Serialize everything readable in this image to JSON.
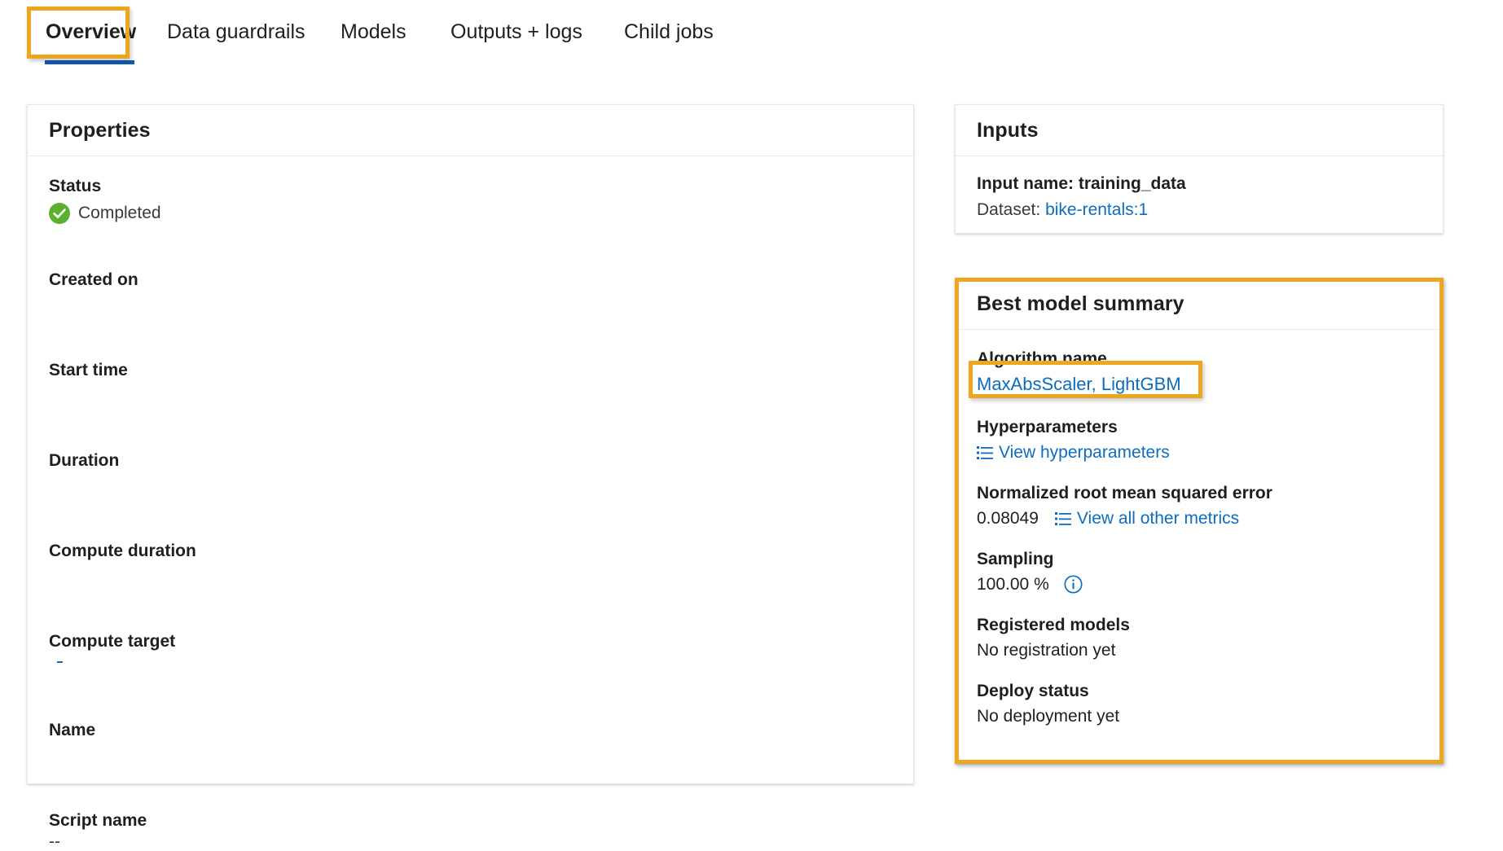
{
  "tabs": [
    {
      "label": "Overview",
      "selected": true
    },
    {
      "label": "Data guardrails",
      "selected": false
    },
    {
      "label": "Models",
      "selected": false
    },
    {
      "label": "Outputs + logs",
      "selected": false
    },
    {
      "label": "Child jobs",
      "selected": false
    }
  ],
  "colors": {
    "annotation_orange": "#eca620",
    "tab_underline_blue": "#0f5bb5",
    "link_blue": "#0f6cbd",
    "status_green": "#5cb030"
  },
  "properties": {
    "title": "Properties",
    "rows": [
      {
        "label": "Status",
        "value": "Completed",
        "icon": "check-circle-icon"
      },
      {
        "label": "Created on",
        "value": ""
      },
      {
        "label": "Start time",
        "value": ""
      },
      {
        "label": "Duration",
        "value": ""
      },
      {
        "label": "Compute duration",
        "value": ""
      },
      {
        "label": "Compute target",
        "value": ""
      },
      {
        "label": "Name",
        "value": ""
      },
      {
        "label": "Script name",
        "value": "--"
      }
    ]
  },
  "inputs": {
    "title": "Inputs",
    "input_name_label": "Input name: training_data",
    "dataset_label": "Dataset:",
    "dataset_link": "bike-rentals:1"
  },
  "best_model": {
    "title": "Best model summary",
    "algorithm_label": "Algorithm name",
    "algorithm_value": "MaxAbsScaler, LightGBM",
    "hyperparameters_label": "Hyperparameters",
    "hyperparameters_link": "View hyperparameters",
    "hyperparameters_icon": "bulleted-list-icon",
    "metric_label": "Normalized root mean squared error",
    "metric_value": "0.08049",
    "metrics_link": "View all other metrics",
    "metrics_icon": "bulleted-list-icon",
    "sampling_label": "Sampling",
    "sampling_value": "100.00 %",
    "sampling_icon": "info-circle-icon",
    "registered_models_label": "Registered models",
    "registered_models_value": "No registration yet",
    "deploy_status_label": "Deploy status",
    "deploy_status_value": "No deployment yet"
  }
}
